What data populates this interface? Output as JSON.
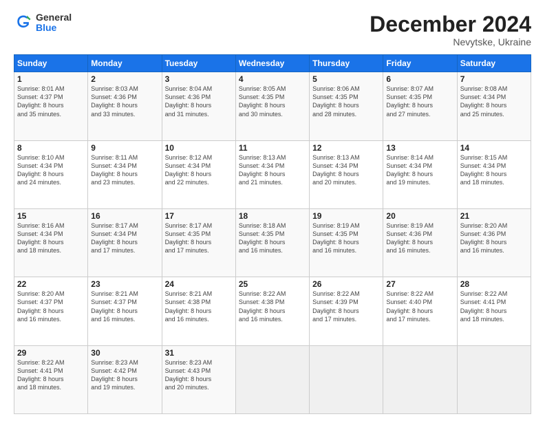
{
  "header": {
    "logo_general": "General",
    "logo_blue": "Blue",
    "title": "December 2024",
    "location": "Nevytske, Ukraine"
  },
  "weekdays": [
    "Sunday",
    "Monday",
    "Tuesday",
    "Wednesday",
    "Thursday",
    "Friday",
    "Saturday"
  ],
  "weeks": [
    [
      {
        "day": "1",
        "sunrise": "Sunrise: 8:01 AM",
        "sunset": "Sunset: 4:37 PM",
        "daylight": "Daylight: 8 hours and 35 minutes."
      },
      {
        "day": "2",
        "sunrise": "Sunrise: 8:03 AM",
        "sunset": "Sunset: 4:36 PM",
        "daylight": "Daylight: 8 hours and 33 minutes."
      },
      {
        "day": "3",
        "sunrise": "Sunrise: 8:04 AM",
        "sunset": "Sunset: 4:36 PM",
        "daylight": "Daylight: 8 hours and 31 minutes."
      },
      {
        "day": "4",
        "sunrise": "Sunrise: 8:05 AM",
        "sunset": "Sunset: 4:35 PM",
        "daylight": "Daylight: 8 hours and 30 minutes."
      },
      {
        "day": "5",
        "sunrise": "Sunrise: 8:06 AM",
        "sunset": "Sunset: 4:35 PM",
        "daylight": "Daylight: 8 hours and 28 minutes."
      },
      {
        "day": "6",
        "sunrise": "Sunrise: 8:07 AM",
        "sunset": "Sunset: 4:35 PM",
        "daylight": "Daylight: 8 hours and 27 minutes."
      },
      {
        "day": "7",
        "sunrise": "Sunrise: 8:08 AM",
        "sunset": "Sunset: 4:34 PM",
        "daylight": "Daylight: 8 hours and 25 minutes."
      }
    ],
    [
      {
        "day": "8",
        "sunrise": "Sunrise: 8:10 AM",
        "sunset": "Sunset: 4:34 PM",
        "daylight": "Daylight: 8 hours and 24 minutes."
      },
      {
        "day": "9",
        "sunrise": "Sunrise: 8:11 AM",
        "sunset": "Sunset: 4:34 PM",
        "daylight": "Daylight: 8 hours and 23 minutes."
      },
      {
        "day": "10",
        "sunrise": "Sunrise: 8:12 AM",
        "sunset": "Sunset: 4:34 PM",
        "daylight": "Daylight: 8 hours and 22 minutes."
      },
      {
        "day": "11",
        "sunrise": "Sunrise: 8:13 AM",
        "sunset": "Sunset: 4:34 PM",
        "daylight": "Daylight: 8 hours and 21 minutes."
      },
      {
        "day": "12",
        "sunrise": "Sunrise: 8:13 AM",
        "sunset": "Sunset: 4:34 PM",
        "daylight": "Daylight: 8 hours and 20 minutes."
      },
      {
        "day": "13",
        "sunrise": "Sunrise: 8:14 AM",
        "sunset": "Sunset: 4:34 PM",
        "daylight": "Daylight: 8 hours and 19 minutes."
      },
      {
        "day": "14",
        "sunrise": "Sunrise: 8:15 AM",
        "sunset": "Sunset: 4:34 PM",
        "daylight": "Daylight: 8 hours and 18 minutes."
      }
    ],
    [
      {
        "day": "15",
        "sunrise": "Sunrise: 8:16 AM",
        "sunset": "Sunset: 4:34 PM",
        "daylight": "Daylight: 8 hours and 18 minutes."
      },
      {
        "day": "16",
        "sunrise": "Sunrise: 8:17 AM",
        "sunset": "Sunset: 4:34 PM",
        "daylight": "Daylight: 8 hours and 17 minutes."
      },
      {
        "day": "17",
        "sunrise": "Sunrise: 8:17 AM",
        "sunset": "Sunset: 4:35 PM",
        "daylight": "Daylight: 8 hours and 17 minutes."
      },
      {
        "day": "18",
        "sunrise": "Sunrise: 8:18 AM",
        "sunset": "Sunset: 4:35 PM",
        "daylight": "Daylight: 8 hours and 16 minutes."
      },
      {
        "day": "19",
        "sunrise": "Sunrise: 8:19 AM",
        "sunset": "Sunset: 4:35 PM",
        "daylight": "Daylight: 8 hours and 16 minutes."
      },
      {
        "day": "20",
        "sunrise": "Sunrise: 8:19 AM",
        "sunset": "Sunset: 4:36 PM",
        "daylight": "Daylight: 8 hours and 16 minutes."
      },
      {
        "day": "21",
        "sunrise": "Sunrise: 8:20 AM",
        "sunset": "Sunset: 4:36 PM",
        "daylight": "Daylight: 8 hours and 16 minutes."
      }
    ],
    [
      {
        "day": "22",
        "sunrise": "Sunrise: 8:20 AM",
        "sunset": "Sunset: 4:37 PM",
        "daylight": "Daylight: 8 hours and 16 minutes."
      },
      {
        "day": "23",
        "sunrise": "Sunrise: 8:21 AM",
        "sunset": "Sunset: 4:37 PM",
        "daylight": "Daylight: 8 hours and 16 minutes."
      },
      {
        "day": "24",
        "sunrise": "Sunrise: 8:21 AM",
        "sunset": "Sunset: 4:38 PM",
        "daylight": "Daylight: 8 hours and 16 minutes."
      },
      {
        "day": "25",
        "sunrise": "Sunrise: 8:22 AM",
        "sunset": "Sunset: 4:38 PM",
        "daylight": "Daylight: 8 hours and 16 minutes."
      },
      {
        "day": "26",
        "sunrise": "Sunrise: 8:22 AM",
        "sunset": "Sunset: 4:39 PM",
        "daylight": "Daylight: 8 hours and 17 minutes."
      },
      {
        "day": "27",
        "sunrise": "Sunrise: 8:22 AM",
        "sunset": "Sunset: 4:40 PM",
        "daylight": "Daylight: 8 hours and 17 minutes."
      },
      {
        "day": "28",
        "sunrise": "Sunrise: 8:22 AM",
        "sunset": "Sunset: 4:41 PM",
        "daylight": "Daylight: 8 hours and 18 minutes."
      }
    ],
    [
      {
        "day": "29",
        "sunrise": "Sunrise: 8:22 AM",
        "sunset": "Sunset: 4:41 PM",
        "daylight": "Daylight: 8 hours and 18 minutes."
      },
      {
        "day": "30",
        "sunrise": "Sunrise: 8:23 AM",
        "sunset": "Sunset: 4:42 PM",
        "daylight": "Daylight: 8 hours and 19 minutes."
      },
      {
        "day": "31",
        "sunrise": "Sunrise: 8:23 AM",
        "sunset": "Sunset: 4:43 PM",
        "daylight": "Daylight: 8 hours and 20 minutes."
      },
      null,
      null,
      null,
      null
    ]
  ]
}
